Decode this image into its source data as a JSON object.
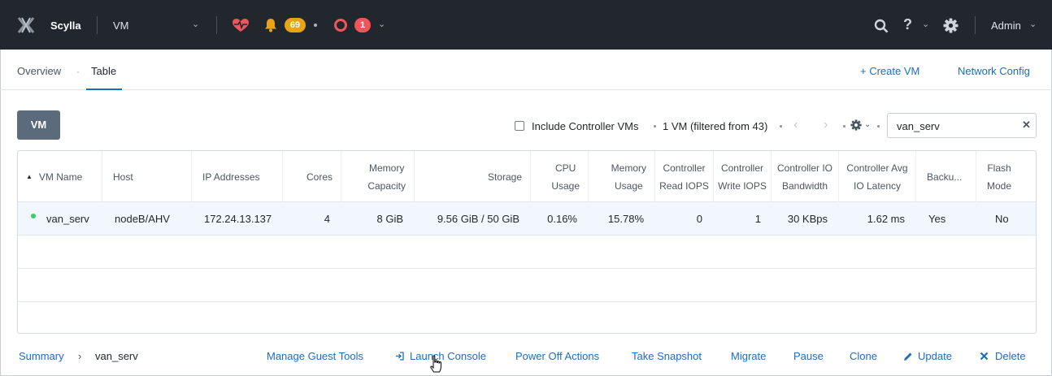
{
  "topbar": {
    "cluster_name": "Scylla",
    "entity_selector": "VM",
    "alert_warning_count": "69",
    "alert_critical_count": "1",
    "user": "Admin",
    "help_label": "?",
    "caret": "⌄"
  },
  "subnav": {
    "tabs": [
      {
        "label": "Overview"
      },
      {
        "label": "Table"
      }
    ],
    "tab_separator": "·",
    "create_vm": "+ Create VM",
    "network_config": "Network Config"
  },
  "toolbar": {
    "vm_button": "VM",
    "include_controller_label": "Include Controller VMs",
    "vm_count": "1 VM (filtered from 43)",
    "dot": "·",
    "prev": "‹",
    "next": "›",
    "caret": "⌄",
    "search_value": "van_serv",
    "clear": "✕"
  },
  "table": {
    "sort_indicator": "▲",
    "columns": [
      {
        "label": "VM Name"
      },
      {
        "label": "Host"
      },
      {
        "label": "IP Addresses"
      },
      {
        "label": "Cores"
      },
      {
        "label": "Memory\nCapacity"
      },
      {
        "label": "Storage"
      },
      {
        "label": "CPU\nUsage"
      },
      {
        "label": "Memory\nUsage"
      },
      {
        "label": "Controller\nRead IOPS"
      },
      {
        "label": "Controller\nWrite IOPS"
      },
      {
        "label": "Controller IO\nBandwidth"
      },
      {
        "label": "Controller Avg\nIO Latency"
      },
      {
        "label": "Backu..."
      },
      {
        "label": "Flash\nMode"
      }
    ],
    "rows": [
      {
        "status": "on",
        "cells": [
          "van_serv",
          "nodeB/AHV",
          "172.24.13.137",
          "4",
          "8 GiB",
          "9.56 GiB / 50 GiB",
          "0.16%",
          "15.78%",
          "0",
          "1",
          "30 KBps",
          "1.62 ms",
          "Yes",
          "No"
        ]
      }
    ]
  },
  "footer": {
    "summary_link": "Summary",
    "crumb_separator": "›",
    "current": "van_serv",
    "actions": {
      "manage_guest_tools": "Manage Guest Tools",
      "launch_console": "Launch Console",
      "power_off_actions": "Power Off Actions",
      "take_snapshot": "Take Snapshot",
      "migrate": "Migrate",
      "pause": "Pause",
      "clone": "Clone",
      "update": "Update",
      "delete": "Delete"
    }
  },
  "colors": {
    "topbar_bg": "#22272e",
    "link": "#1b6dc1",
    "warning": "#e8a317",
    "critical": "#f2545b",
    "health": "#f2545b",
    "status_on": "#36d068",
    "vm_button_bg": "#5b6b7c",
    "selected_row": "#f1f7fd"
  },
  "icons": [
    "x-logo-icon",
    "heart-pulse-icon",
    "bell-icon",
    "critical-ring-icon",
    "search-icon",
    "gear-icon",
    "pointer-cursor-icon"
  ]
}
